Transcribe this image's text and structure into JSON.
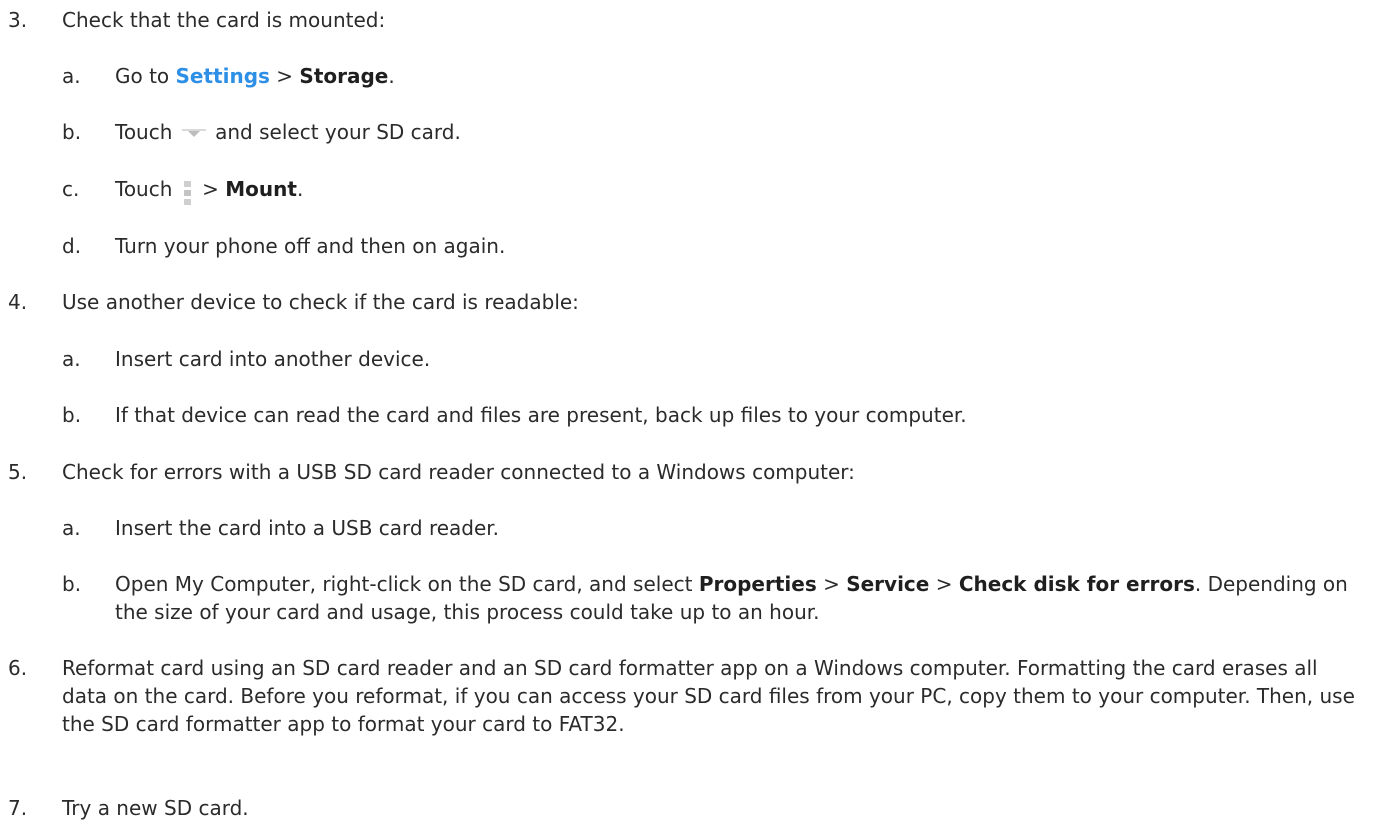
{
  "steps": {
    "s3": {
      "num": "3.",
      "text": "Check that the card is mounted:",
      "a": {
        "letter": "a.",
        "pre": "Go to ",
        "link": "Settings",
        "sep": " > ",
        "bold": "Storage",
        "post": "."
      },
      "b": {
        "letter": "b.",
        "pre": "Touch ",
        "post": " and select your SD card.",
        "icon": "dropdown-arrow-icon"
      },
      "c": {
        "letter": "c.",
        "pre": "Touch ",
        "sep": " > ",
        "bold": "Mount",
        "post": ".",
        "icon": "overflow-menu-icon"
      },
      "d": {
        "letter": "d.",
        "text": "Turn your phone off and then on again."
      }
    },
    "s4": {
      "num": "4.",
      "text": "Use another device to check if the card is readable:",
      "a": {
        "letter": "a.",
        "text": "Insert card into another device."
      },
      "b": {
        "letter": "b.",
        "text": "If that device can read the card and files are present, back up files to your computer."
      }
    },
    "s5": {
      "num": "5.",
      "text": "Check for errors with a USB SD card reader connected to a Windows computer:",
      "a": {
        "letter": "a.",
        "text": "Insert the card into a USB card reader."
      },
      "b": {
        "letter": "b.",
        "pre": "Open My Computer, right-click on the SD card, and select ",
        "bold1": "Properties",
        "sep1": " > ",
        "bold2": "Service",
        "sep2": " > ",
        "bold3": "Check disk for errors",
        "post": ". Depending on the size of your card and usage, this process could take up to an hour."
      }
    },
    "s6": {
      "num": "6.",
      "text": "Reformat card using an SD card reader and an SD card formatter app on a Windows computer. Formatting the card erases all data on the card. Before you reformat, if you can access your SD card files from your PC, copy them to your computer. Then, use the SD card formatter app to format your card to FAT32."
    },
    "s7": {
      "num": "7.",
      "text": "Try a new SD card."
    }
  },
  "colors": {
    "link": "#2e8fe6",
    "text": "#2b2b2b"
  }
}
